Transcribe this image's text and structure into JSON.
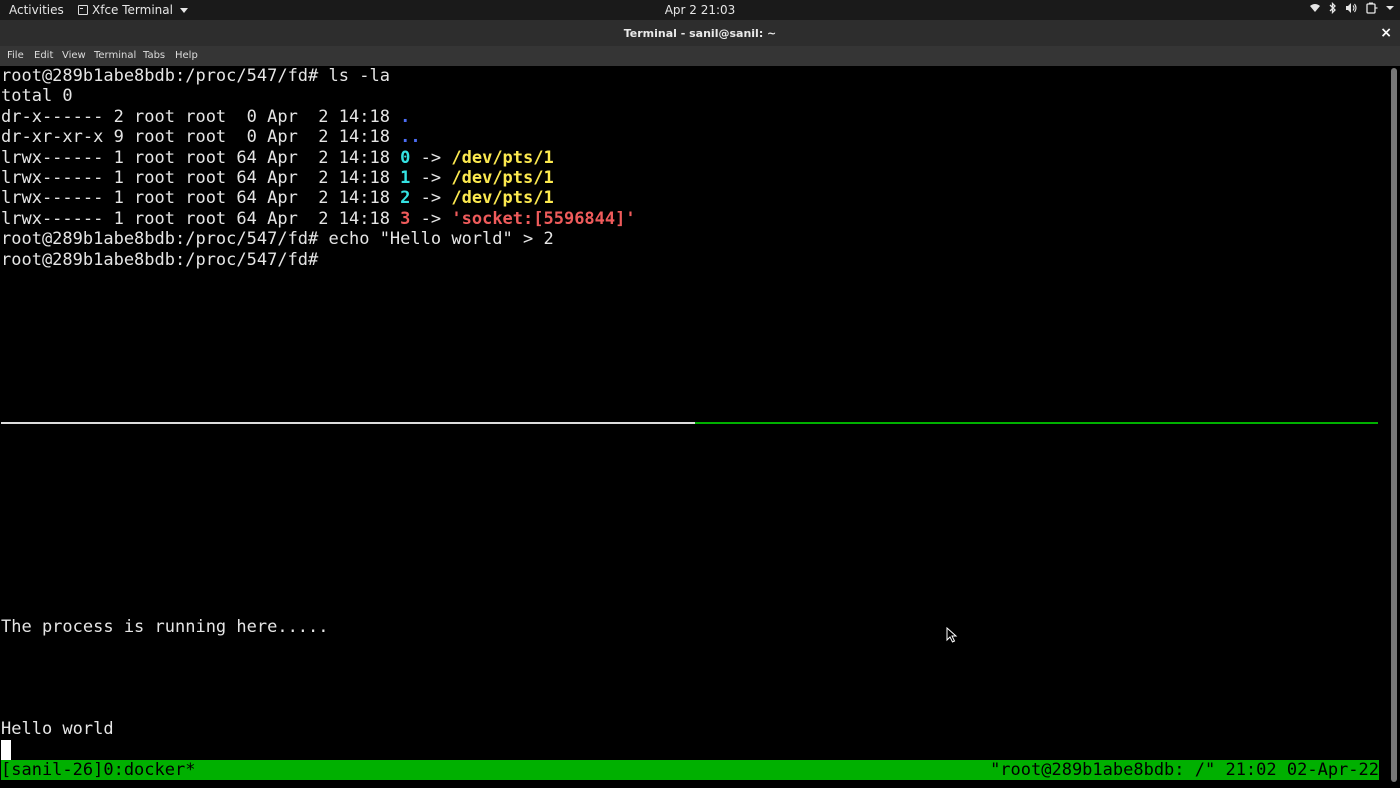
{
  "topbar": {
    "activities": "Activities",
    "app_name": "Xfce Terminal",
    "clock": "Apr 2  21:03",
    "tray_icons": [
      "wifi-icon",
      "bluetooth-icon",
      "volume-icon",
      "battery-icon",
      "power-menu-icon"
    ]
  },
  "window": {
    "title": "Terminal - sanil@sanil: ~",
    "close": "×"
  },
  "menubar": {
    "items": [
      "File",
      "Edit",
      "View",
      "Terminal",
      "Tabs",
      "Help"
    ]
  },
  "terminal": {
    "lines": [
      {
        "text": "root@289b1abe8bdb:/proc/547/fd# ls -la"
      },
      {
        "text": "total 0"
      },
      {
        "prefix": "dr-x------ 2 root root  0 Apr  2 14:18 ",
        "name": "."
      },
      {
        "prefix": "dr-xr-xr-x 9 root root  0 Apr  2 14:18 ",
        "name": ".."
      },
      {
        "prefix": "lrwx------ 1 root root 64 Apr  2 14:18 ",
        "name": "0",
        "arrow": " -> ",
        "target": "/dev/pts/1"
      },
      {
        "prefix": "lrwx------ 1 root root 64 Apr  2 14:18 ",
        "name": "1",
        "arrow": " -> ",
        "target": "/dev/pts/1"
      },
      {
        "prefix": "lrwx------ 1 root root 64 Apr  2 14:18 ",
        "name": "2",
        "arrow": " -> ",
        "target": "/dev/pts/1"
      },
      {
        "prefix": "lrwx------ 1 root root 64 Apr  2 14:18 ",
        "name": "3",
        "arrow": " -> ",
        "target": "'socket:[5596844]'"
      },
      {
        "text": "root@289b1abe8bdb:/proc/547/fd# echo \"Hello world\" > 2"
      },
      {
        "text": "root@289b1abe8bdb:/proc/547/fd# "
      }
    ],
    "lower_pane": {
      "line1": "The process is running here.....",
      "line2": "Hello world"
    },
    "status": {
      "left": "[sanil-26]0:docker*",
      "right": "\"root@289b1abe8bdb: /\" 21:02 02-Apr-22"
    }
  }
}
